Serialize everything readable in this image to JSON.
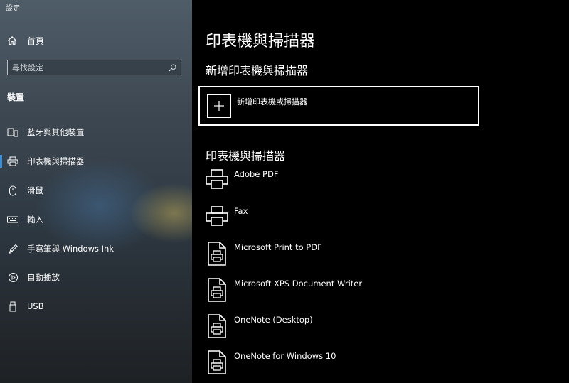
{
  "window": {
    "title": "設定"
  },
  "sidebar": {
    "home_label": "首頁",
    "search_placeholder": "尋找設定",
    "section_title": "裝置",
    "items": [
      {
        "label": "藍牙與其他裝置",
        "icon": "bluetooth-devices-icon"
      },
      {
        "label": "印表機與掃描器",
        "icon": "printer-icon",
        "active": true
      },
      {
        "label": "滑鼠",
        "icon": "mouse-icon"
      },
      {
        "label": "輸入",
        "icon": "keyboard-icon"
      },
      {
        "label": "手寫筆與 Windows Ink",
        "icon": "pen-icon"
      },
      {
        "label": "自動播放",
        "icon": "autoplay-icon"
      },
      {
        "label": "USB",
        "icon": "usb-icon"
      }
    ]
  },
  "main": {
    "title": "印表機與掃描器",
    "add_section_title": "新增印表機與掃描器",
    "add_button_label": "新增印表機或掃描器",
    "list_title": "印表機與掃描器",
    "printers": [
      {
        "name": "Adobe PDF",
        "icon": "printer-icon"
      },
      {
        "name": "Fax",
        "icon": "printer-icon"
      },
      {
        "name": "Microsoft Print to PDF",
        "icon": "document-printer-icon"
      },
      {
        "name": "Microsoft XPS Document Writer",
        "icon": "document-printer-icon"
      },
      {
        "name": "OneNote (Desktop)",
        "icon": "document-printer-icon"
      },
      {
        "name": "OneNote for Windows 10",
        "icon": "document-printer-icon"
      }
    ]
  },
  "colors": {
    "accent": "#3b8fd9",
    "background": "#000000"
  }
}
